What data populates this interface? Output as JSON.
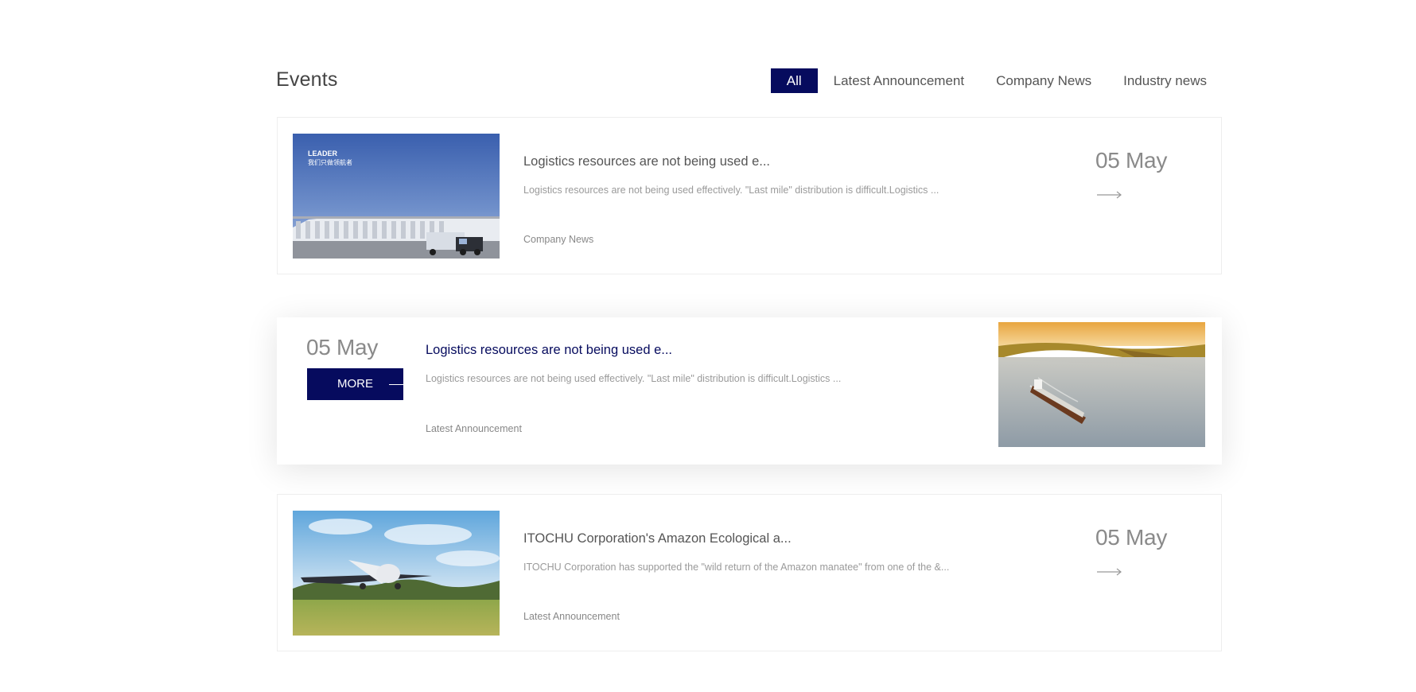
{
  "section": {
    "title": "Events"
  },
  "tabs": [
    {
      "label": "All",
      "active": true
    },
    {
      "label": "Latest Announcement",
      "active": false
    },
    {
      "label": "Company News",
      "active": false
    },
    {
      "label": "Industry news",
      "active": false
    }
  ],
  "articles": [
    {
      "image": "warehouse-truck-image",
      "image_caption_line1": "LEADER",
      "image_caption_line2": "我们只做领航者",
      "headline": "Logistics resources are not being used e...",
      "summary": "Logistics resources are not being used effectively. \"Last mile\" distribution is difficult.Logistics ...",
      "category": "Company News",
      "date": "05 May",
      "arrow_icon": "long-arrow-right-icon"
    },
    {
      "image": "cargo-ship-river-image",
      "headline": "Logistics resources are not being used e...",
      "summary": "Logistics resources are not being used effectively. \"Last mile\" distribution is difficult.Logistics ...",
      "category": "Latest Announcement",
      "date": "05 May",
      "more_label": "MORE"
    },
    {
      "image": "airplane-takeoff-image",
      "headline": "ITOCHU Corporation's Amazon Ecological a...",
      "summary": "ITOCHU Corporation has supported the \"wild return of the Amazon manatee\" from one of the &...",
      "category": "Latest Announcement",
      "date": "05 May",
      "arrow_icon": "long-arrow-right-icon"
    }
  ],
  "colors": {
    "accent": "#060b5e",
    "text_muted": "#9a9a9a",
    "border": "#eeeeee"
  }
}
